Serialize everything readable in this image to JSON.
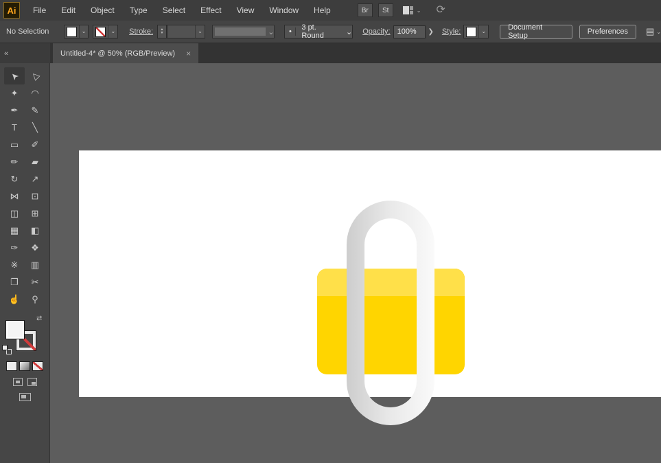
{
  "icons": {
    "caret": "⌄",
    "chevron_right": "❯",
    "stepper_up": "▲",
    "stepper_down": "▼",
    "close": "×",
    "collapse": "«",
    "swap": "⇄",
    "bullet": "•",
    "panel": "▤",
    "touch": "⟳"
  },
  "app_bar": {
    "logo": "Ai",
    "menus": [
      "File",
      "Edit",
      "Object",
      "Type",
      "Select",
      "Effect",
      "View",
      "Window",
      "Help"
    ],
    "bridge": "Br",
    "stock": "St"
  },
  "control_bar": {
    "selection_status": "No Selection",
    "stroke_label": "Stroke:",
    "stroke_weight_value": "",
    "brush_preset": "3 pt. Round",
    "opacity_label": "Opacity:",
    "opacity_value": "100%",
    "style_label": "Style:",
    "document_setup": "Document Setup",
    "preferences": "Preferences"
  },
  "tab_bar": {
    "active_tab": "Untitled-4* @ 50% (RGB/Preview)"
  },
  "tools": [
    {
      "label": "Selection Tool",
      "glyph": "➤"
    },
    {
      "label": "Direct Selection Tool",
      "glyph": "▷"
    },
    {
      "label": "Magic Wand Tool",
      "glyph": "✦"
    },
    {
      "label": "Lasso Tool",
      "glyph": "◠"
    },
    {
      "label": "Pen Tool",
      "glyph": "✒"
    },
    {
      "label": "Curvature Tool",
      "glyph": "✎"
    },
    {
      "label": "Type Tool",
      "glyph": "T"
    },
    {
      "label": "Line Segment Tool",
      "glyph": "╲"
    },
    {
      "label": "Rectangle Tool",
      "glyph": "▭"
    },
    {
      "label": "Paintbrush Tool",
      "glyph": "✐"
    },
    {
      "label": "Pencil Tool",
      "glyph": "✏"
    },
    {
      "label": "Eraser Tool",
      "glyph": "▰"
    },
    {
      "label": "Rotate Tool",
      "glyph": "↻"
    },
    {
      "label": "Scale Tool",
      "glyph": "↗"
    },
    {
      "label": "Width Tool",
      "glyph": "⋈"
    },
    {
      "label": "Free Transform Tool",
      "glyph": "⊡"
    },
    {
      "label": "Shape Builder Tool",
      "glyph": "◫"
    },
    {
      "label": "Perspective Grid Tool",
      "glyph": "⊞"
    },
    {
      "label": "Mesh Tool",
      "glyph": "▦"
    },
    {
      "label": "Gradient Tool",
      "glyph": "◧"
    },
    {
      "label": "Eyedropper Tool",
      "glyph": "✑"
    },
    {
      "label": "Blend Tool",
      "glyph": "❖"
    },
    {
      "label": "Symbol Sprayer Tool",
      "glyph": "※"
    },
    {
      "label": "Column Graph Tool",
      "glyph": "▥"
    },
    {
      "label": "Artboard Tool",
      "glyph": "❐"
    },
    {
      "label": "Slice Tool",
      "glyph": "✂"
    },
    {
      "label": "Hand Tool",
      "glyph": "☝"
    },
    {
      "label": "Zoom Tool",
      "glyph": "⚲"
    }
  ],
  "artwork": {
    "lock_body_color": "#ffd500",
    "lock_band_color": "#ffe049",
    "ring_gradient_start": "#cdcdcd",
    "ring_gradient_mid": "#e9e9e9",
    "ring_gradient_end": "#fafafa"
  }
}
